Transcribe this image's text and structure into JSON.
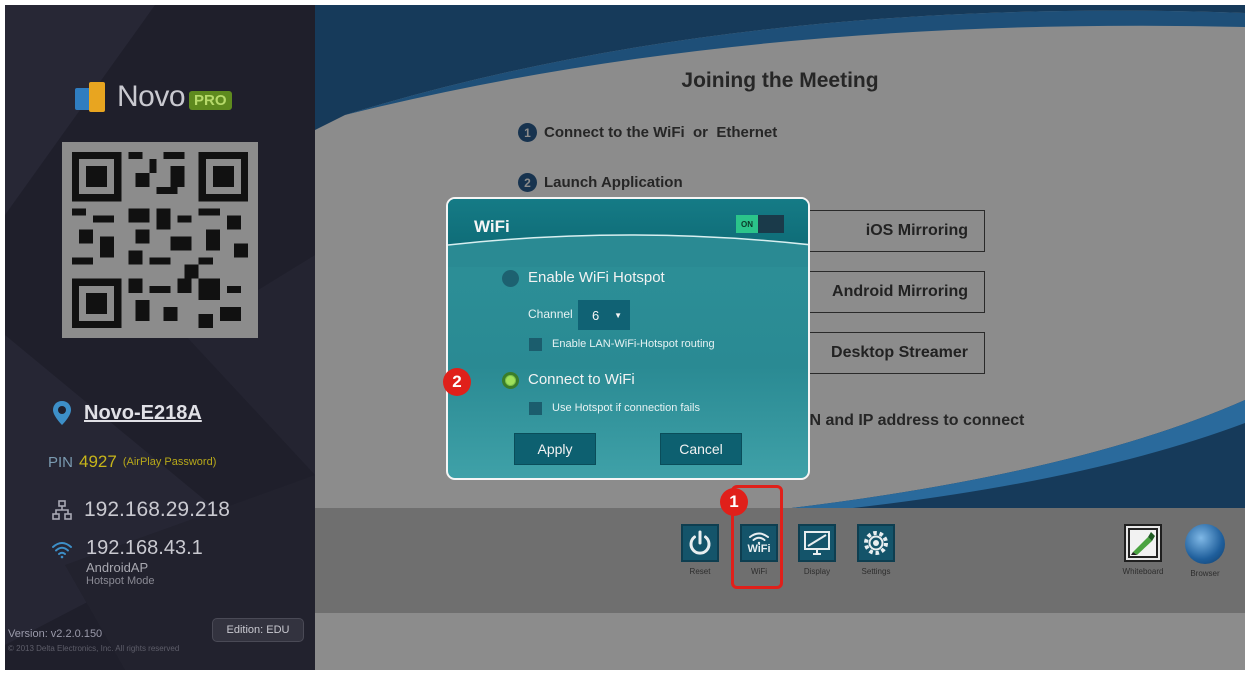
{
  "sidebar": {
    "logo_text": "Novo",
    "logo_badge": "PRO",
    "device_name": "Novo-E218A",
    "pin_label": "PIN",
    "pin_value": "4927",
    "pin_note": "(AirPlay Password)",
    "lan_ip": "192.168.29.218",
    "hotspot_ip": "192.168.43.1",
    "hotspot_ssid": "AndroidAP",
    "hotspot_mode": "Hotspot Mode",
    "version": "Version: v2.2.0.150",
    "copyright": "© 2013 Delta Electronics, Inc. All rights reserved",
    "edition": "Edition: EDU"
  },
  "main": {
    "title": "Joining the Meeting",
    "step1_num": "1",
    "step1_text": "Connect to the WiFi  or  Ethernet",
    "step2_num": "2",
    "step2_text": "Launch Application",
    "app_buttons": [
      "iOS Mirroring",
      "Android Mirroring",
      "Desktop Streamer"
    ],
    "connect_text": "IN and IP address to connect"
  },
  "toolbar": {
    "reset": "Reset",
    "wifi": "WiFi",
    "wifi_icon_text": "WiFi",
    "display": "Display",
    "settings": "Settings",
    "whiteboard": "Whiteboard",
    "browser": "Browser"
  },
  "dialog": {
    "title": "WiFi",
    "toggle_label": "ON",
    "option_hotspot": "Enable WiFi Hotspot",
    "channel_label": "Channel",
    "channel_value": "6",
    "lan_routing": "Enable LAN-WiFi-Hotspot routing",
    "option_connect": "Connect to WiFi",
    "use_hotspot": "Use Hotspot if connection fails",
    "apply": "Apply",
    "cancel": "Cancel"
  },
  "annotations": {
    "badge1": "1",
    "badge2": "2"
  },
  "colors": {
    "accent_teal": "#2a8a93",
    "highlight_red": "#e0201a",
    "sidebar_bg": "#1f1f2b",
    "pin_yellow": "#c7b51a"
  }
}
